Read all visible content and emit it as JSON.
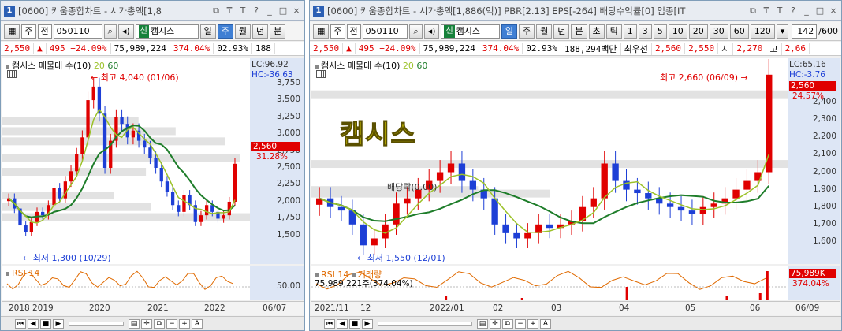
{
  "left": {
    "title_num": "1",
    "title": "[0600] 키움종합차트 - 시가총액[1,8",
    "toolbar": {
      "mode": "주",
      "type": "전",
      "code": "050110",
      "signal": "신",
      "name": "캠시스",
      "periods": [
        "일",
        "주",
        "월",
        "년",
        "분"
      ],
      "selected_period": "주"
    },
    "info": {
      "price": "2,550",
      "arrow": "▲",
      "change": "495 +24.09%",
      "volume": "75,989,224",
      "vol_pct": "374.04%",
      "turnover": "02.93%",
      "extra": "188"
    },
    "legend": {
      "label": "캠시스 매물대 수(10)",
      "ma1": "20",
      "ma2": "60"
    },
    "high_note": "최고 4,040 (01/06)",
    "low_note": "최저 1,300 (10/29)",
    "lc": "LC:96.92",
    "hc": "HC:-36.63",
    "y_labels": [
      "3,750",
      "3,500",
      "3,250",
      "3,000",
      "2,750",
      "2,500",
      "2,250",
      "2,000",
      "1,750",
      "1,500"
    ],
    "price_tag": "2,560",
    "pct_tag": "31.28%",
    "x_labels": [
      "2018",
      "2019",
      "2020",
      "2021",
      "2022"
    ],
    "date_tag": "06/07",
    "rsi_label": "RSI 14",
    "rsi_y": "50.00"
  },
  "right": {
    "title_num": "1",
    "title": "[0600] 키움종합차트 - 시가총액[1,886(억)] PBR[2.13] EPS[-264] 배당수익률[0] 업종[IT",
    "toolbar": {
      "mode": "주",
      "type": "전",
      "code": "050110",
      "signal": "신",
      "name": "캠시스",
      "periods": [
        "일",
        "주",
        "월",
        "년",
        "분",
        "초",
        "틱"
      ],
      "selected_period": "일",
      "intervals": [
        "1",
        "3",
        "5",
        "10",
        "20",
        "30",
        "60",
        "120"
      ],
      "count": "142",
      "total": "/600"
    },
    "info": {
      "price": "2,550",
      "arrow": "▲",
      "change": "495 +24.09%",
      "volume": "75,989,224",
      "vol_pct": "374.04%",
      "turnover": "02.93%",
      "amount": "188,294백만",
      "best": "최우선",
      "ask": "2,560",
      "bid": "2,550",
      "start_lbl": "시",
      "open": "2,270",
      "high_lbl": "고",
      "high": "2,66"
    },
    "legend": {
      "label": "캠시스 매물대 수(10)",
      "ma1": "20",
      "ma2": "60"
    },
    "big_title": "캠시스",
    "high_note": "최고 2,660 (06/09)",
    "low_note": "최저 1,550 (12/01)",
    "dividend_note": "배당락(0.00)",
    "lc": "LC:65.16",
    "hc": "HC:-3.76",
    "y_labels": [
      "2,400",
      "2,300",
      "2,200",
      "2,100",
      "2,000",
      "1,900",
      "1,800",
      "1,700",
      "1,600"
    ],
    "price_tag": "2,560",
    "pct_tag": "24.57%",
    "x_labels": [
      "2021/11",
      "12",
      "2022/01",
      "02",
      "03",
      "04",
      "05",
      "06"
    ],
    "date_tag": "06/09",
    "rsi_label": "RSI 14",
    "vol_label": "거래량",
    "vol_note": "75,989,221주(374.04%)",
    "vol_tag": "75,989K",
    "vol_pct_tag": "374.04%"
  },
  "colors": {
    "up": "#e00000",
    "down": "#1d3fd6",
    "ma20": "#9cc22a",
    "ma60": "#1e7d2a",
    "volume_profile": "#e2e2e2"
  },
  "chart_data": [
    {
      "type": "candlestick",
      "name": "weekly",
      "title": "캠시스",
      "x": [
        "2018",
        "2019",
        "2020",
        "2021",
        "2022",
        "06/07"
      ],
      "ylim": [
        1300,
        4040
      ],
      "last": 2560,
      "high": 4040,
      "low": 1300,
      "series_close": [
        2050,
        1900,
        1650,
        1550,
        1700,
        1850,
        1800,
        1950,
        2200,
        2050,
        2300,
        2450,
        2700,
        2950,
        3500,
        3700,
        3300,
        2500,
        2900,
        3250,
        3150,
        2950,
        3050,
        2900,
        2800,
        2650,
        2500,
        2300,
        2150,
        1950,
        1850,
        2100,
        1950,
        1700,
        1800,
        1950,
        1850,
        1750,
        1800,
        2000,
        2560
      ]
    },
    {
      "type": "candlestick",
      "name": "daily",
      "title": "캠시스",
      "x": [
        "2021/11",
        "12",
        "2022/01",
        "02",
        "03",
        "04",
        "05",
        "06",
        "06/09"
      ],
      "ylim": [
        1550,
        2660
      ],
      "last": 2560,
      "high": 2660,
      "low": 1550,
      "series_close": [
        1850,
        1800,
        1780,
        1700,
        1580,
        1620,
        1700,
        1820,
        1850,
        1900,
        1950,
        2000,
        2050,
        1950,
        1900,
        1850,
        1700,
        1650,
        1620,
        1650,
        1700,
        1680,
        1700,
        1720,
        1800,
        1850,
        2050,
        1950,
        1900,
        1880,
        1850,
        1820,
        1800,
        1780,
        1760,
        1800,
        1820,
        1850,
        1900,
        1950,
        2000,
        2560
      ]
    }
  ]
}
